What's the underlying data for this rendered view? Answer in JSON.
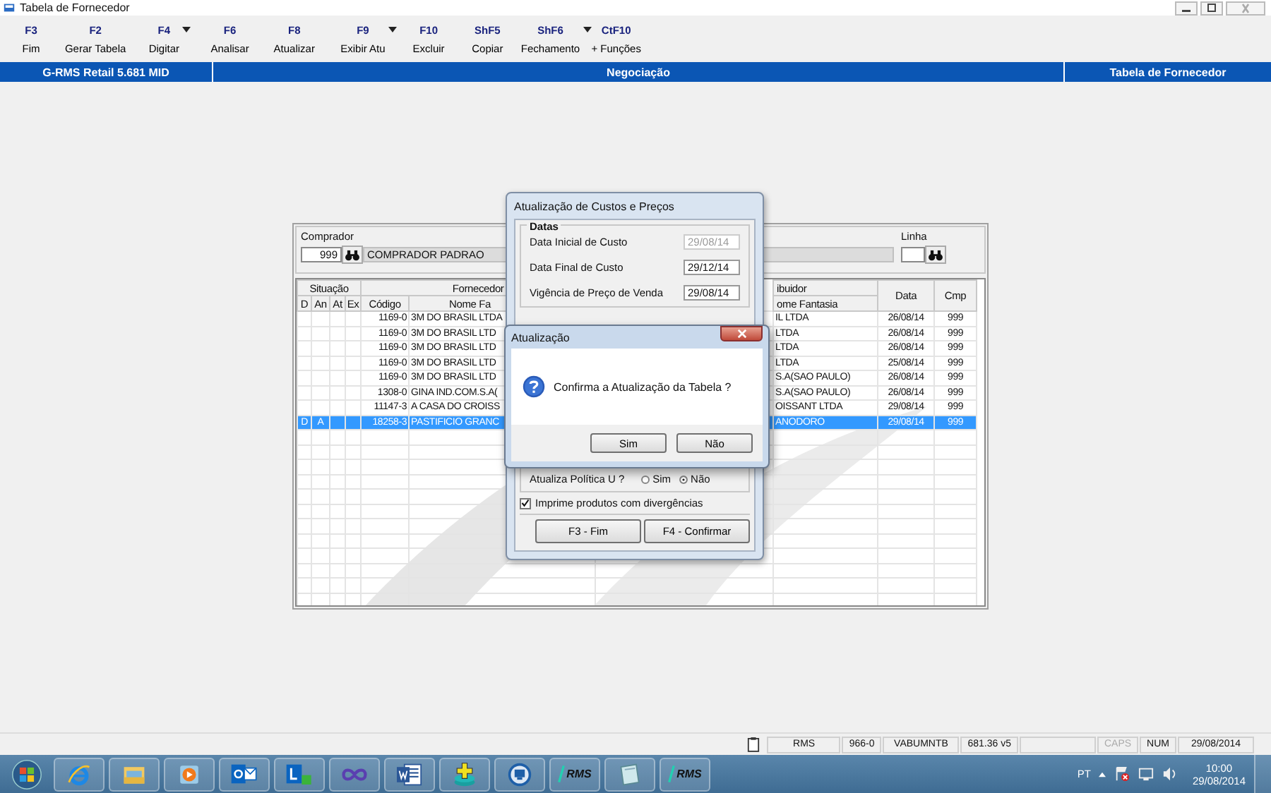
{
  "window": {
    "title": "Tabela de Fornecedor"
  },
  "toolbar": [
    {
      "key": "F3",
      "label": "Fim",
      "dropdown": false
    },
    {
      "key": "F2",
      "label": "Gerar Tabela",
      "dropdown": false
    },
    {
      "key": "F4",
      "label": "Digitar",
      "dropdown": true
    },
    {
      "key": "F6",
      "label": "Analisar",
      "dropdown": false
    },
    {
      "key": "F8",
      "label": "Atualizar",
      "dropdown": false
    },
    {
      "key": "F9",
      "label": "Exibir Atu",
      "dropdown": true
    },
    {
      "key": "F10",
      "label": "Excluir",
      "dropdown": false
    },
    {
      "key": "ShF5",
      "label": "Copiar",
      "dropdown": false
    },
    {
      "key": "ShF6",
      "label": "Fechamento",
      "dropdown": true
    },
    {
      "key": "CtF10",
      "label": "+ Funções",
      "dropdown": false
    }
  ],
  "header_bar": {
    "system": "G-RMS Retail 5.681 MID",
    "module": "Negociação",
    "screen": "Tabela de Fornecedor"
  },
  "comprador": {
    "label": "Comprador",
    "code": "999",
    "name": "COMPRADOR PADRAO"
  },
  "linha": {
    "label": "Linha"
  },
  "table": {
    "group_headers": {
      "situacao": "Situação",
      "fornecedor": "Fornecedor",
      "distribuidor": "ibuidor"
    },
    "columns": {
      "d": "D",
      "an": "An",
      "at": "At",
      "ex": "Ex",
      "codigo": "Código",
      "fornecedor_nome": "Nome Fa",
      "distribuidor_nome": "ome Fantasia",
      "data": "Data",
      "cmp": "Cmp"
    },
    "rows": [
      {
        "codigo": "1169-0",
        "fornecedor": "3M DO BRASIL LTDA",
        "distribuidor": "IL LTDA",
        "data": "26/08/14",
        "cmp": "999",
        "selected": false
      },
      {
        "codigo": "1169-0",
        "fornecedor": "3M DO BRASIL LTD",
        "distribuidor": "LTDA",
        "data": "26/08/14",
        "cmp": "999",
        "selected": false
      },
      {
        "codigo": "1169-0",
        "fornecedor": "3M DO BRASIL LTD",
        "distribuidor": "LTDA",
        "data": "26/08/14",
        "cmp": "999",
        "selected": false
      },
      {
        "codigo": "1169-0",
        "fornecedor": "3M DO BRASIL LTD",
        "distribuidor": "LTDA",
        "data": "25/08/14",
        "cmp": "999",
        "selected": false
      },
      {
        "codigo": "1169-0",
        "fornecedor": "3M DO BRASIL LTD",
        "distribuidor": "S.A(SAO PAULO)",
        "data": "26/08/14",
        "cmp": "999",
        "selected": false
      },
      {
        "codigo": "1308-0",
        "fornecedor": "GINA IND.COM.S.A(",
        "distribuidor": "S.A(SAO PAULO)",
        "data": "26/08/14",
        "cmp": "999",
        "selected": false
      },
      {
        "codigo": "11147-3",
        "fornecedor": "A CASA DO CROISS",
        "distribuidor": "OISSANT LTDA",
        "data": "29/08/14",
        "cmp": "999",
        "selected": false
      },
      {
        "d": "D",
        "an": "A",
        "codigo": "18258-3",
        "fornecedor": "PASTIFICIO GRANC",
        "distribuidor": "ANODORO",
        "data": "29/08/14",
        "cmp": "999",
        "selected": true
      }
    ]
  },
  "dialog_custos": {
    "title": "Atualização de Custos e Preços",
    "group": "Datas",
    "fields": [
      {
        "label": "Data Inicial de Custo",
        "value": "29/08/14",
        "disabled": true
      },
      {
        "label": "Data Final de Custo",
        "value": "29/12/14",
        "disabled": false
      },
      {
        "label": "Vigência de Preço de Venda",
        "value": "29/08/14",
        "disabled": false
      }
    ],
    "politica": {
      "label": "Atualiza Política U ?",
      "options": [
        {
          "label": "Sim",
          "selected": false
        },
        {
          "label": "Não",
          "selected": true
        }
      ]
    },
    "checkbox": {
      "label": "Imprime produtos com divergências",
      "checked": true
    },
    "buttons": [
      "F3 - Fim",
      "F4 - Confirmar"
    ]
  },
  "dialog_confirm": {
    "title": "Atualização",
    "message": "Confirma a Atualização da Tabela ?",
    "buttons": [
      "Sim",
      "Não"
    ]
  },
  "status_bar": [
    {
      "kind": "icon"
    },
    {
      "kind": "text",
      "text": "RMS",
      "disabled": false
    },
    {
      "kind": "text",
      "text": "966-0",
      "disabled": false
    },
    {
      "kind": "text",
      "text": "VABUMNTB",
      "disabled": false
    },
    {
      "kind": "text",
      "text": "681.36 v5",
      "disabled": false
    },
    {
      "kind": "empty"
    },
    {
      "kind": "text",
      "text": "CAPS",
      "disabled": true
    },
    {
      "kind": "text",
      "text": "NUM",
      "disabled": false
    },
    {
      "kind": "text",
      "text": "29/08/2014",
      "disabled": false
    }
  ],
  "taskbar": {
    "apps": [
      {
        "kind": "browser"
      },
      {
        "kind": "folder"
      },
      {
        "kind": "media"
      },
      {
        "kind": "mail"
      },
      {
        "kind": "lync"
      },
      {
        "kind": "infinity"
      },
      {
        "kind": "word"
      },
      {
        "kind": "plus"
      },
      {
        "kind": "remote"
      },
      {
        "kind": "rms",
        "label": "RMS"
      },
      {
        "kind": "notepad"
      },
      {
        "kind": "rms",
        "label": "RMS"
      }
    ],
    "tray": {
      "language": "PT",
      "time": "10:00",
      "date": "29/08/2014"
    }
  }
}
